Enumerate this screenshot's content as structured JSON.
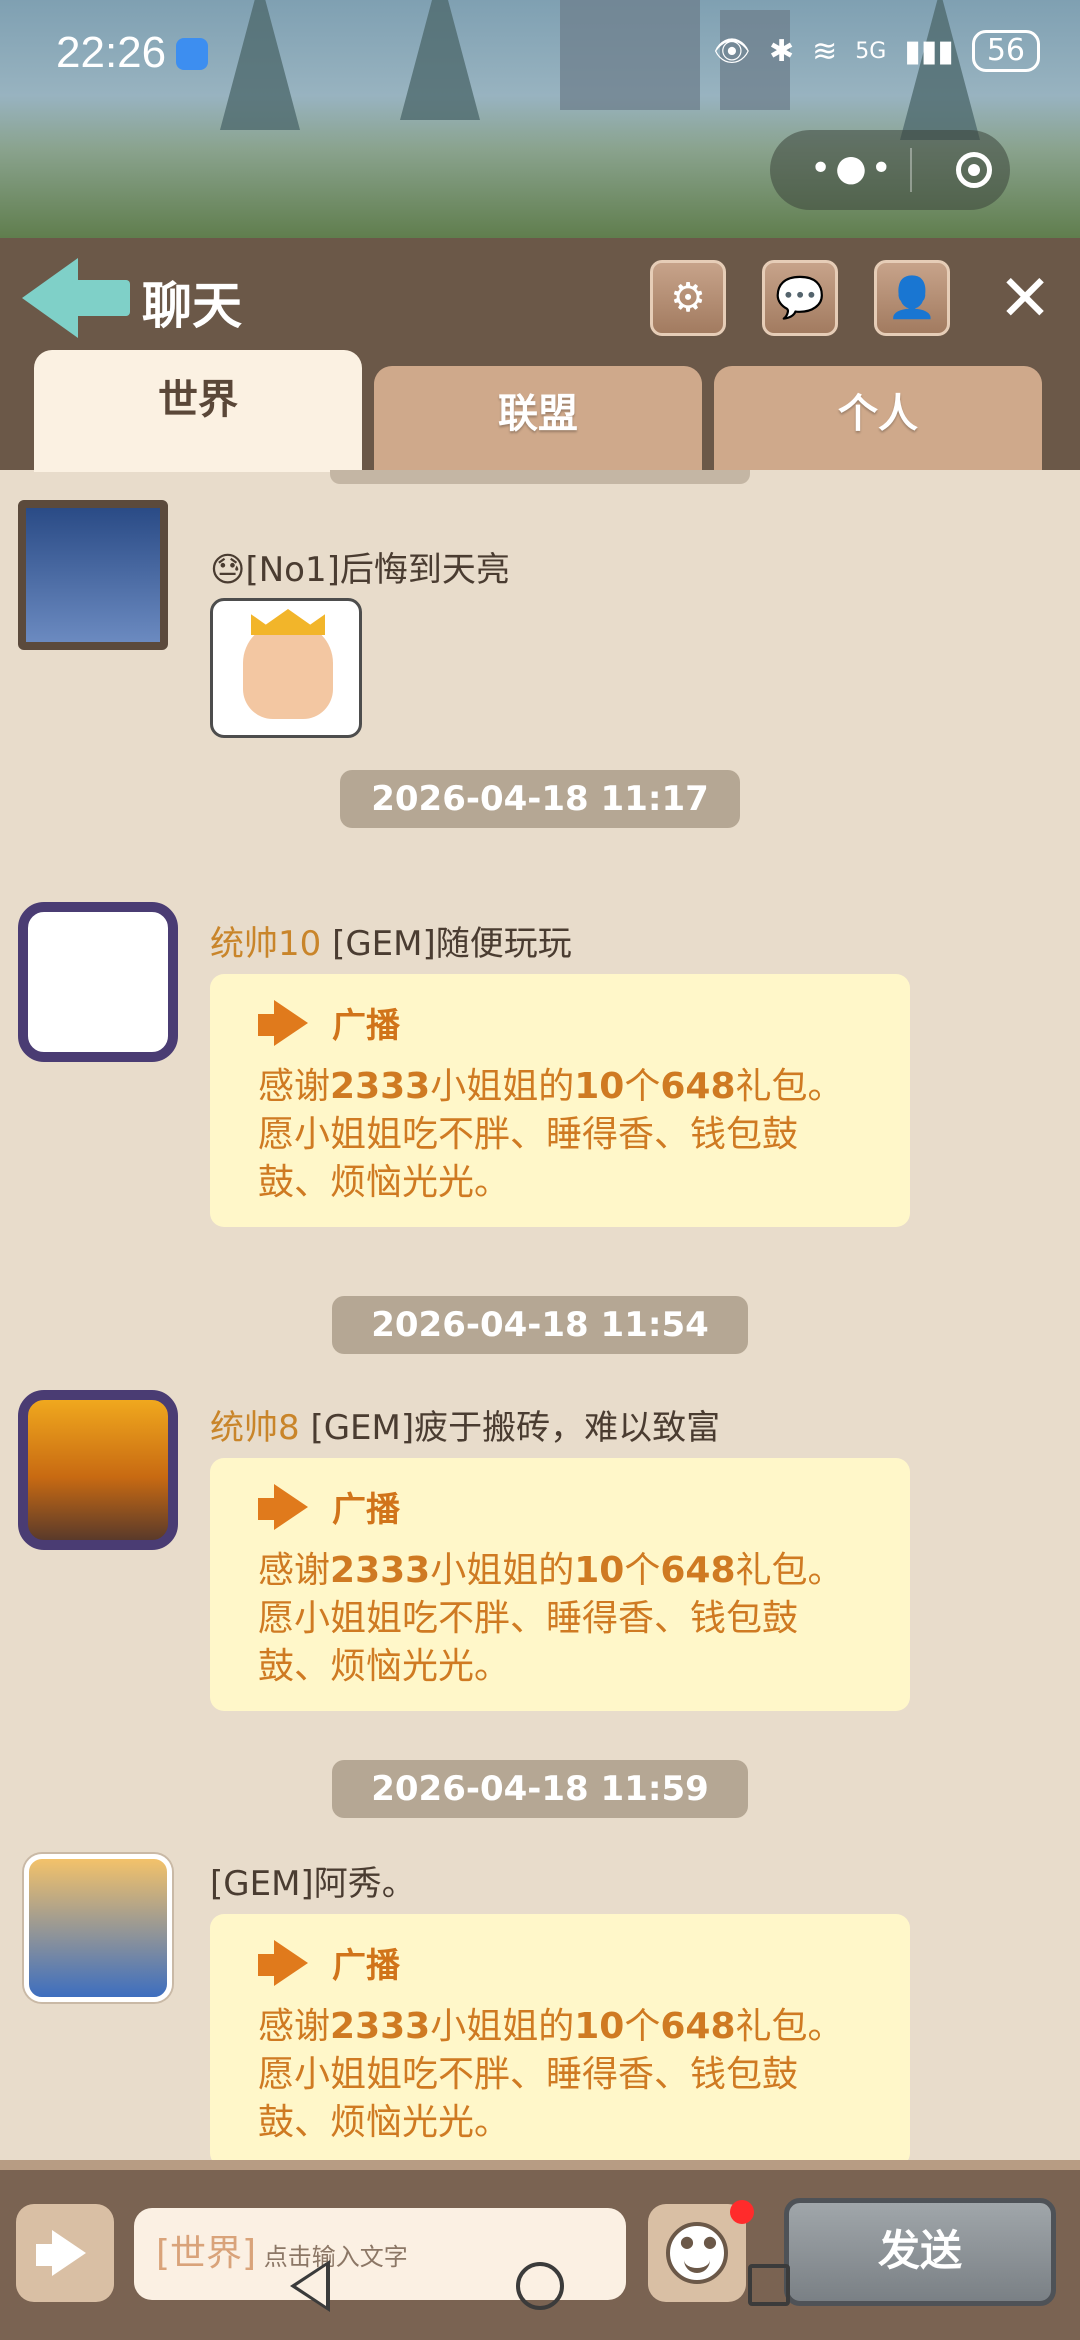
{
  "status_bar": {
    "time": "22:26",
    "network": "5G",
    "battery": "56"
  },
  "header": {
    "title": "聊天"
  },
  "tabs": [
    {
      "label": "世界",
      "active": true
    },
    {
      "label": "联盟",
      "active": false
    },
    {
      "label": "个人",
      "active": false
    }
  ],
  "messages": [
    {
      "type": "sticker",
      "name": "[No1]后悔到天亮"
    },
    {
      "type": "broadcast",
      "timestamp": "2026-04-18 11:17",
      "rank": "统帅10",
      "name": " [GEM]随便玩玩",
      "bubble_title": "广播",
      "text_parts": [
        "感谢",
        "2333",
        "小姐姐的",
        "10",
        "个",
        "648",
        "礼包。愿小姐姐吃不胖、睡得香、钱包鼓鼓、烦恼光光。"
      ]
    },
    {
      "type": "broadcast",
      "timestamp": "2026-04-18 11:54",
      "rank": "统帅8",
      "name": " [GEM]疲于搬砖，难以致富",
      "bubble_title": "广播",
      "text_parts": [
        "感谢",
        "2333",
        "小姐姐的",
        "10",
        "个",
        "648",
        "礼包。愿小姐姐吃不胖、睡得香、钱包鼓鼓、烦恼光光。"
      ]
    },
    {
      "type": "broadcast",
      "timestamp": "2026-04-18 11:59",
      "rank": "",
      "name": "[GEM]阿秀。",
      "bubble_title": "广播",
      "text_parts": [
        "感谢",
        "2333",
        "小姐姐的",
        "10",
        "个",
        "648",
        "礼包。愿小姐姐吃不胖、睡得香、钱包鼓鼓、烦恼光光。"
      ]
    }
  ],
  "input": {
    "channel": "[世界]",
    "placeholder": "点击输入文字"
  },
  "send_label": "发送",
  "colors": {
    "header_bg": "#6b5848",
    "chat_bg": "#e8dccb",
    "bubble_bg": "#fff7c9",
    "broadcast_text": "#cf7a22",
    "rank_text": "#c9852a",
    "timestamp_bg": "#b5a794",
    "tab_active": "#fbf1e2",
    "tab_inactive": "#cfa98b",
    "accent_back": "#7fd0c8"
  }
}
